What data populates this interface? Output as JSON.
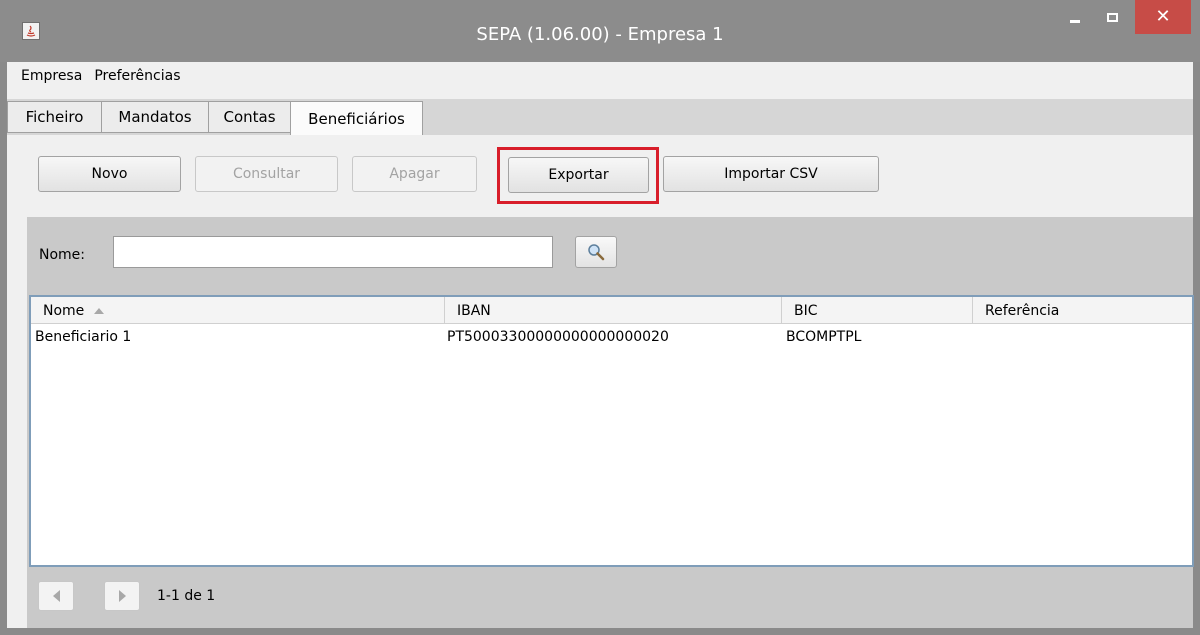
{
  "window": {
    "title": "SEPA  (1.06.00) - Empresa 1",
    "close_symbol": "✕"
  },
  "menu": [
    "Empresa",
    "Preferências"
  ],
  "tabs": [
    {
      "label": "Ficheiro"
    },
    {
      "label": "Mandatos"
    },
    {
      "label": "Contas"
    },
    {
      "label": "Beneficiários",
      "active": true
    }
  ],
  "toolbar": {
    "novo": "Novo",
    "consultar": "Consultar",
    "apagar": "Apagar",
    "exportar": "Exportar",
    "importar": "Importar CSV"
  },
  "filter": {
    "label": "Nome:",
    "value": "",
    "search_icon": "magnifier-icon"
  },
  "table": {
    "columns": [
      "Nome",
      "IBAN",
      "BIC",
      "Referência"
    ],
    "sorted_column": "Nome",
    "rows": [
      {
        "nome": "Beneficiario 1",
        "iban": "PT50003300000000000000020",
        "bic": "BCOMPTPL",
        "referencia": ""
      }
    ]
  },
  "pager": {
    "info": "1-1 de 1"
  },
  "colors": {
    "highlight": "#d81e2a",
    "titlebar": "#8c8c8c",
    "close": "#c74c47"
  }
}
